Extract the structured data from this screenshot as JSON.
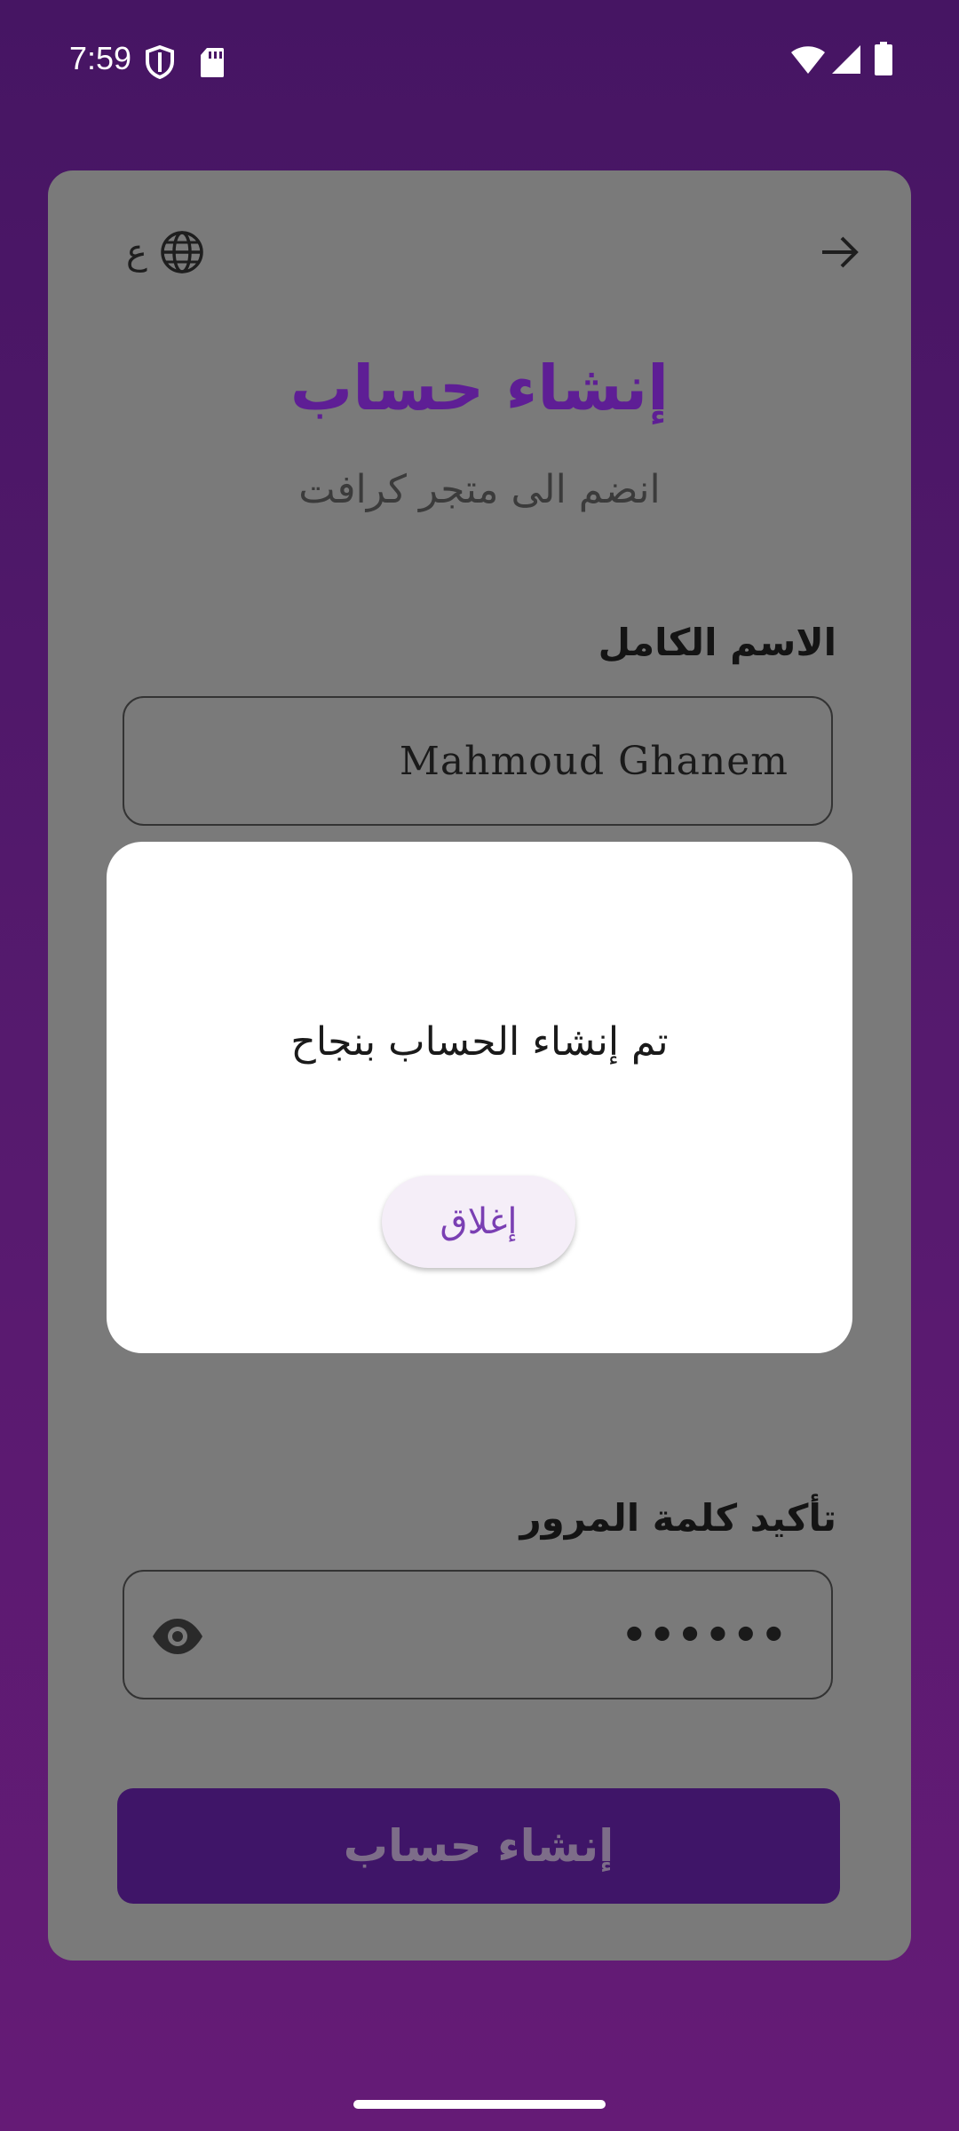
{
  "status_bar": {
    "time": "7:59"
  },
  "header": {
    "language_letter": "ع",
    "language_icon": "globe-icon",
    "back_icon": "arrow-forward-icon"
  },
  "form": {
    "title": "إنشاء حساب",
    "subtitle": "انضم الى متجر كرافت",
    "full_name_label": "الاسم الكامل",
    "full_name_value": "Mahmoud Ghanem",
    "confirm_password_label": "تأكيد كلمة المرور",
    "confirm_password_value": "••••••",
    "submit_label": "إنشاء حساب"
  },
  "dialog": {
    "message": "تم إنشاء الحساب بنجاح",
    "close_label": "إغلاق"
  },
  "colors": {
    "background_top": "#461563",
    "background_bottom": "#651b76",
    "accent": "#7a3fb3",
    "submit_button": "#3f1568"
  }
}
